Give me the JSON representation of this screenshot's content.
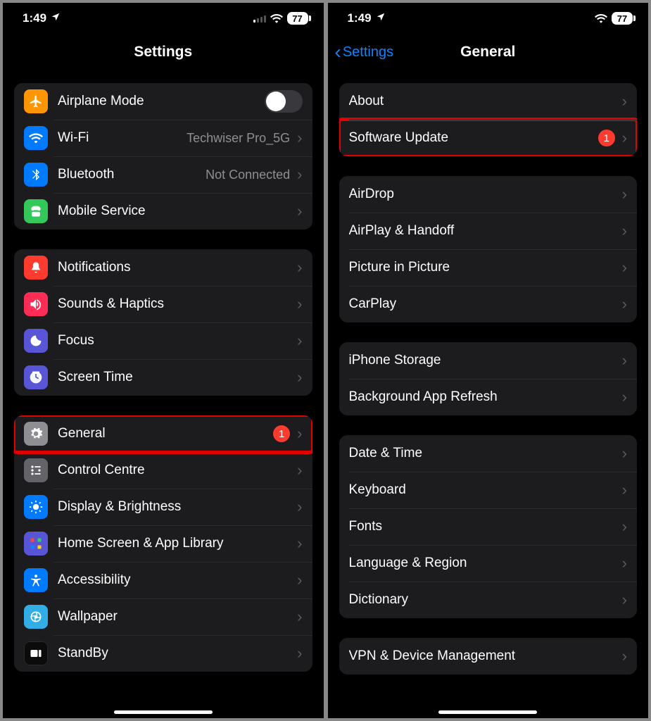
{
  "status": {
    "time": "1:49",
    "battery": "77"
  },
  "left": {
    "title": "Settings",
    "groups": [
      {
        "rows": [
          {
            "id": "airplane",
            "label": "Airplane Mode",
            "kind": "toggle"
          },
          {
            "id": "wifi",
            "label": "Wi-Fi",
            "detail": "Techwiser Pro_5G"
          },
          {
            "id": "bluetooth",
            "label": "Bluetooth",
            "detail": "Not Connected"
          },
          {
            "id": "mobile",
            "label": "Mobile Service"
          }
        ]
      },
      {
        "rows": [
          {
            "id": "notifications",
            "label": "Notifications"
          },
          {
            "id": "sounds",
            "label": "Sounds & Haptics"
          },
          {
            "id": "focus",
            "label": "Focus"
          },
          {
            "id": "screentime",
            "label": "Screen Time"
          }
        ]
      },
      {
        "rows": [
          {
            "id": "general",
            "label": "General",
            "badge": "1",
            "highlight": true
          },
          {
            "id": "control",
            "label": "Control Centre"
          },
          {
            "id": "display",
            "label": "Display & Brightness"
          },
          {
            "id": "home",
            "label": "Home Screen & App Library"
          },
          {
            "id": "accessibility",
            "label": "Accessibility"
          },
          {
            "id": "wallpaper",
            "label": "Wallpaper"
          },
          {
            "id": "standby",
            "label": "StandBy"
          }
        ]
      }
    ]
  },
  "right": {
    "back": "Settings",
    "title": "General",
    "groups": [
      {
        "rows": [
          {
            "id": "about",
            "label": "About"
          },
          {
            "id": "software",
            "label": "Software Update",
            "badge": "1",
            "highlight": true
          }
        ]
      },
      {
        "rows": [
          {
            "id": "airdrop",
            "label": "AirDrop"
          },
          {
            "id": "airplay",
            "label": "AirPlay & Handoff"
          },
          {
            "id": "pip",
            "label": "Picture in Picture"
          },
          {
            "id": "carplay",
            "label": "CarPlay"
          }
        ]
      },
      {
        "rows": [
          {
            "id": "storage",
            "label": "iPhone Storage"
          },
          {
            "id": "bgrefresh",
            "label": "Background App Refresh"
          }
        ]
      },
      {
        "rows": [
          {
            "id": "datetime",
            "label": "Date & Time"
          },
          {
            "id": "keyboard",
            "label": "Keyboard"
          },
          {
            "id": "fonts",
            "label": "Fonts"
          },
          {
            "id": "language",
            "label": "Language & Region"
          },
          {
            "id": "dictionary",
            "label": "Dictionary"
          }
        ]
      },
      {
        "rows": [
          {
            "id": "vpn",
            "label": "VPN & Device Management"
          }
        ]
      }
    ]
  }
}
